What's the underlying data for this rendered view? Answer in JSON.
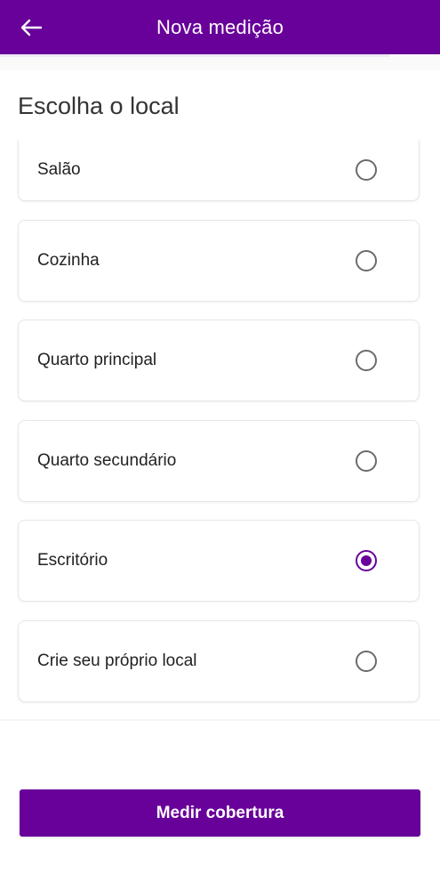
{
  "header": {
    "title": "Nova medição",
    "back_icon": "arrow-left-icon",
    "color": "#68009a"
  },
  "section": {
    "title": "Escolha o local"
  },
  "locations": [
    {
      "label": "Salão",
      "selected": false
    },
    {
      "label": "Cozinha",
      "selected": false
    },
    {
      "label": "Quarto principal",
      "selected": false
    },
    {
      "label": "Quarto secundário",
      "selected": false
    },
    {
      "label": "Escritório",
      "selected": true
    },
    {
      "label": "Crie seu próprio local",
      "selected": false
    }
  ],
  "footer": {
    "button_label": "Medir cobertura"
  },
  "colors": {
    "accent": "#68009a",
    "radio_off": "#6b6b6b"
  }
}
